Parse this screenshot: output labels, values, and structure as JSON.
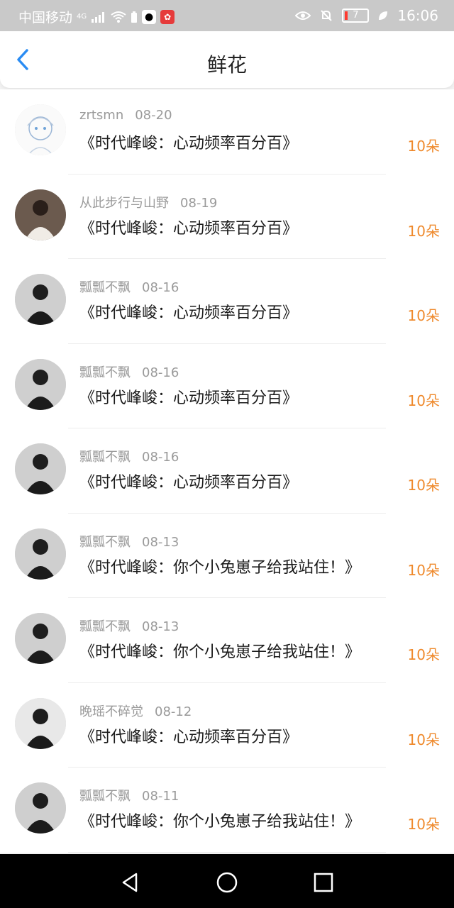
{
  "statusbar": {
    "carrier": "中国移动",
    "network": "4G",
    "battery_level": "7",
    "time": "16:06"
  },
  "nav": {
    "title": "鲜花"
  },
  "rows": [
    {
      "username": "zrtsmn",
      "date": "08-20",
      "book": "《时代峰峻：心动频率百分百》",
      "count": "10朵"
    },
    {
      "username": "从此步行与山野",
      "date": "08-19",
      "book": "《时代峰峻：心动频率百分百》",
      "count": "10朵"
    },
    {
      "username": "瓢瓢不飘",
      "date": "08-16",
      "book": "《时代峰峻：心动频率百分百》",
      "count": "10朵"
    },
    {
      "username": "瓢瓢不飘",
      "date": "08-16",
      "book": "《时代峰峻：心动频率百分百》",
      "count": "10朵"
    },
    {
      "username": "瓢瓢不飘",
      "date": "08-16",
      "book": "《时代峰峻：心动频率百分百》",
      "count": "10朵"
    },
    {
      "username": "瓢瓢不飘",
      "date": "08-13",
      "book": "《时代峰峻：你个小兔崽子给我站住！》",
      "count": "10朵"
    },
    {
      "username": "瓢瓢不飘",
      "date": "08-13",
      "book": "《时代峰峻：你个小兔崽子给我站住！》",
      "count": "10朵"
    },
    {
      "username": "晚瑶不碎觉",
      "date": "08-12",
      "book": "《时代峰峻：心动频率百分百》",
      "count": "10朵"
    },
    {
      "username": "瓢瓢不飘",
      "date": "08-11",
      "book": "《时代峰峻：你个小兔崽子给我站住！》",
      "count": "10朵"
    }
  ]
}
